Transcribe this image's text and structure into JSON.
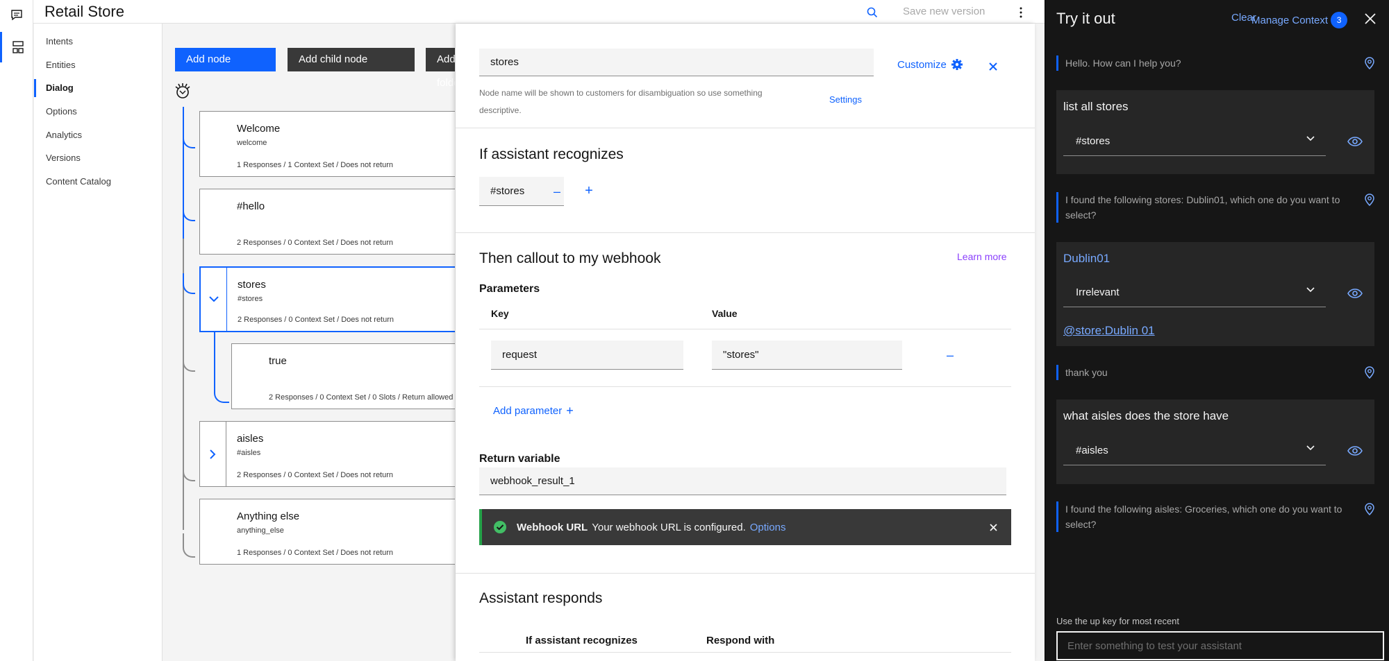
{
  "app": {
    "title": "Retail Store"
  },
  "header": {
    "save_version_label": "Save new version"
  },
  "leftnav": {
    "items": [
      {
        "label": "Intents",
        "active": false
      },
      {
        "label": "Entities",
        "active": false
      },
      {
        "label": "Dialog",
        "active": true
      },
      {
        "label": "Options",
        "active": false
      },
      {
        "label": "Analytics",
        "active": false
      },
      {
        "label": "Versions",
        "active": false
      },
      {
        "label": "Content Catalog",
        "active": false
      }
    ]
  },
  "canvas": {
    "add_node_label": "Add node",
    "add_child_node_label": "Add child node",
    "add_folder_label": "Add folder",
    "nodes": [
      {
        "title": "Welcome",
        "condition": "welcome",
        "meta": "1 Responses / 1 Context Set / Does not return"
      },
      {
        "title": "#hello",
        "condition": "",
        "meta": "2 Responses / 0 Context Set / Does not return"
      },
      {
        "title": "stores",
        "condition": "#stores",
        "meta": "2 Responses / 0 Context Set / Does not return"
      },
      {
        "title": "true",
        "condition": "",
        "meta": "2 Responses / 0 Context Set / 0 Slots / Return allowed"
      },
      {
        "title": "aisles",
        "condition": "#aisles",
        "meta": "2 Responses / 0 Context Set / Does not return"
      },
      {
        "title": "Anything else",
        "condition": "anything_else",
        "meta": "1 Responses / 0 Context Set / Does not return"
      }
    ]
  },
  "editor": {
    "node_name": "stores",
    "helper_text": "Node name will be shown to customers for disambiguation so use something descriptive.",
    "settings_label": "Settings",
    "customize_label": "Customize",
    "recognizes_title": "If assistant recognizes",
    "condition": "#stores",
    "webhook_title": "Then callout to my webhook",
    "learn_more_label": "Learn more",
    "parameters_label": "Parameters",
    "key_header": "Key",
    "value_header": "Value",
    "param_key": "request",
    "param_value": "\"stores\"",
    "add_parameter_label": "Add parameter",
    "return_variable_label": "Return variable",
    "return_variable": "webhook_result_1",
    "toast": {
      "title": "Webhook URL",
      "message": "Your webhook URL is configured.",
      "link": "Options"
    },
    "responds_title": "Assistant responds",
    "responds_col1": "If assistant recognizes",
    "responds_col2": "Respond with"
  },
  "tryit": {
    "title": "Try it out",
    "clear_label": "Clear",
    "manage_context_label": "Manage Context",
    "context_count": "3",
    "messages": [
      {
        "bot": "Hello. How can I help you?"
      },
      {
        "user": "list all stores",
        "intent": "#stores"
      },
      {
        "bot": "I found the following stores: Dublin01, which one do you want to select?"
      },
      {
        "user": "Dublin01",
        "intent": "Irrelevant",
        "entity": "@store:Dublin 01"
      },
      {
        "bot": "thank you"
      },
      {
        "user": "what aisles does the store have",
        "intent": "#aisles"
      },
      {
        "bot": "I found the following aisles: Groceries, which one do you want to select?"
      }
    ],
    "hint": "Use the up key for most recent",
    "input_placeholder": "Enter something to test your assistant"
  },
  "colors": {
    "accent": "#0f62fe",
    "dark_panel": "#161616",
    "success": "#24a148"
  }
}
